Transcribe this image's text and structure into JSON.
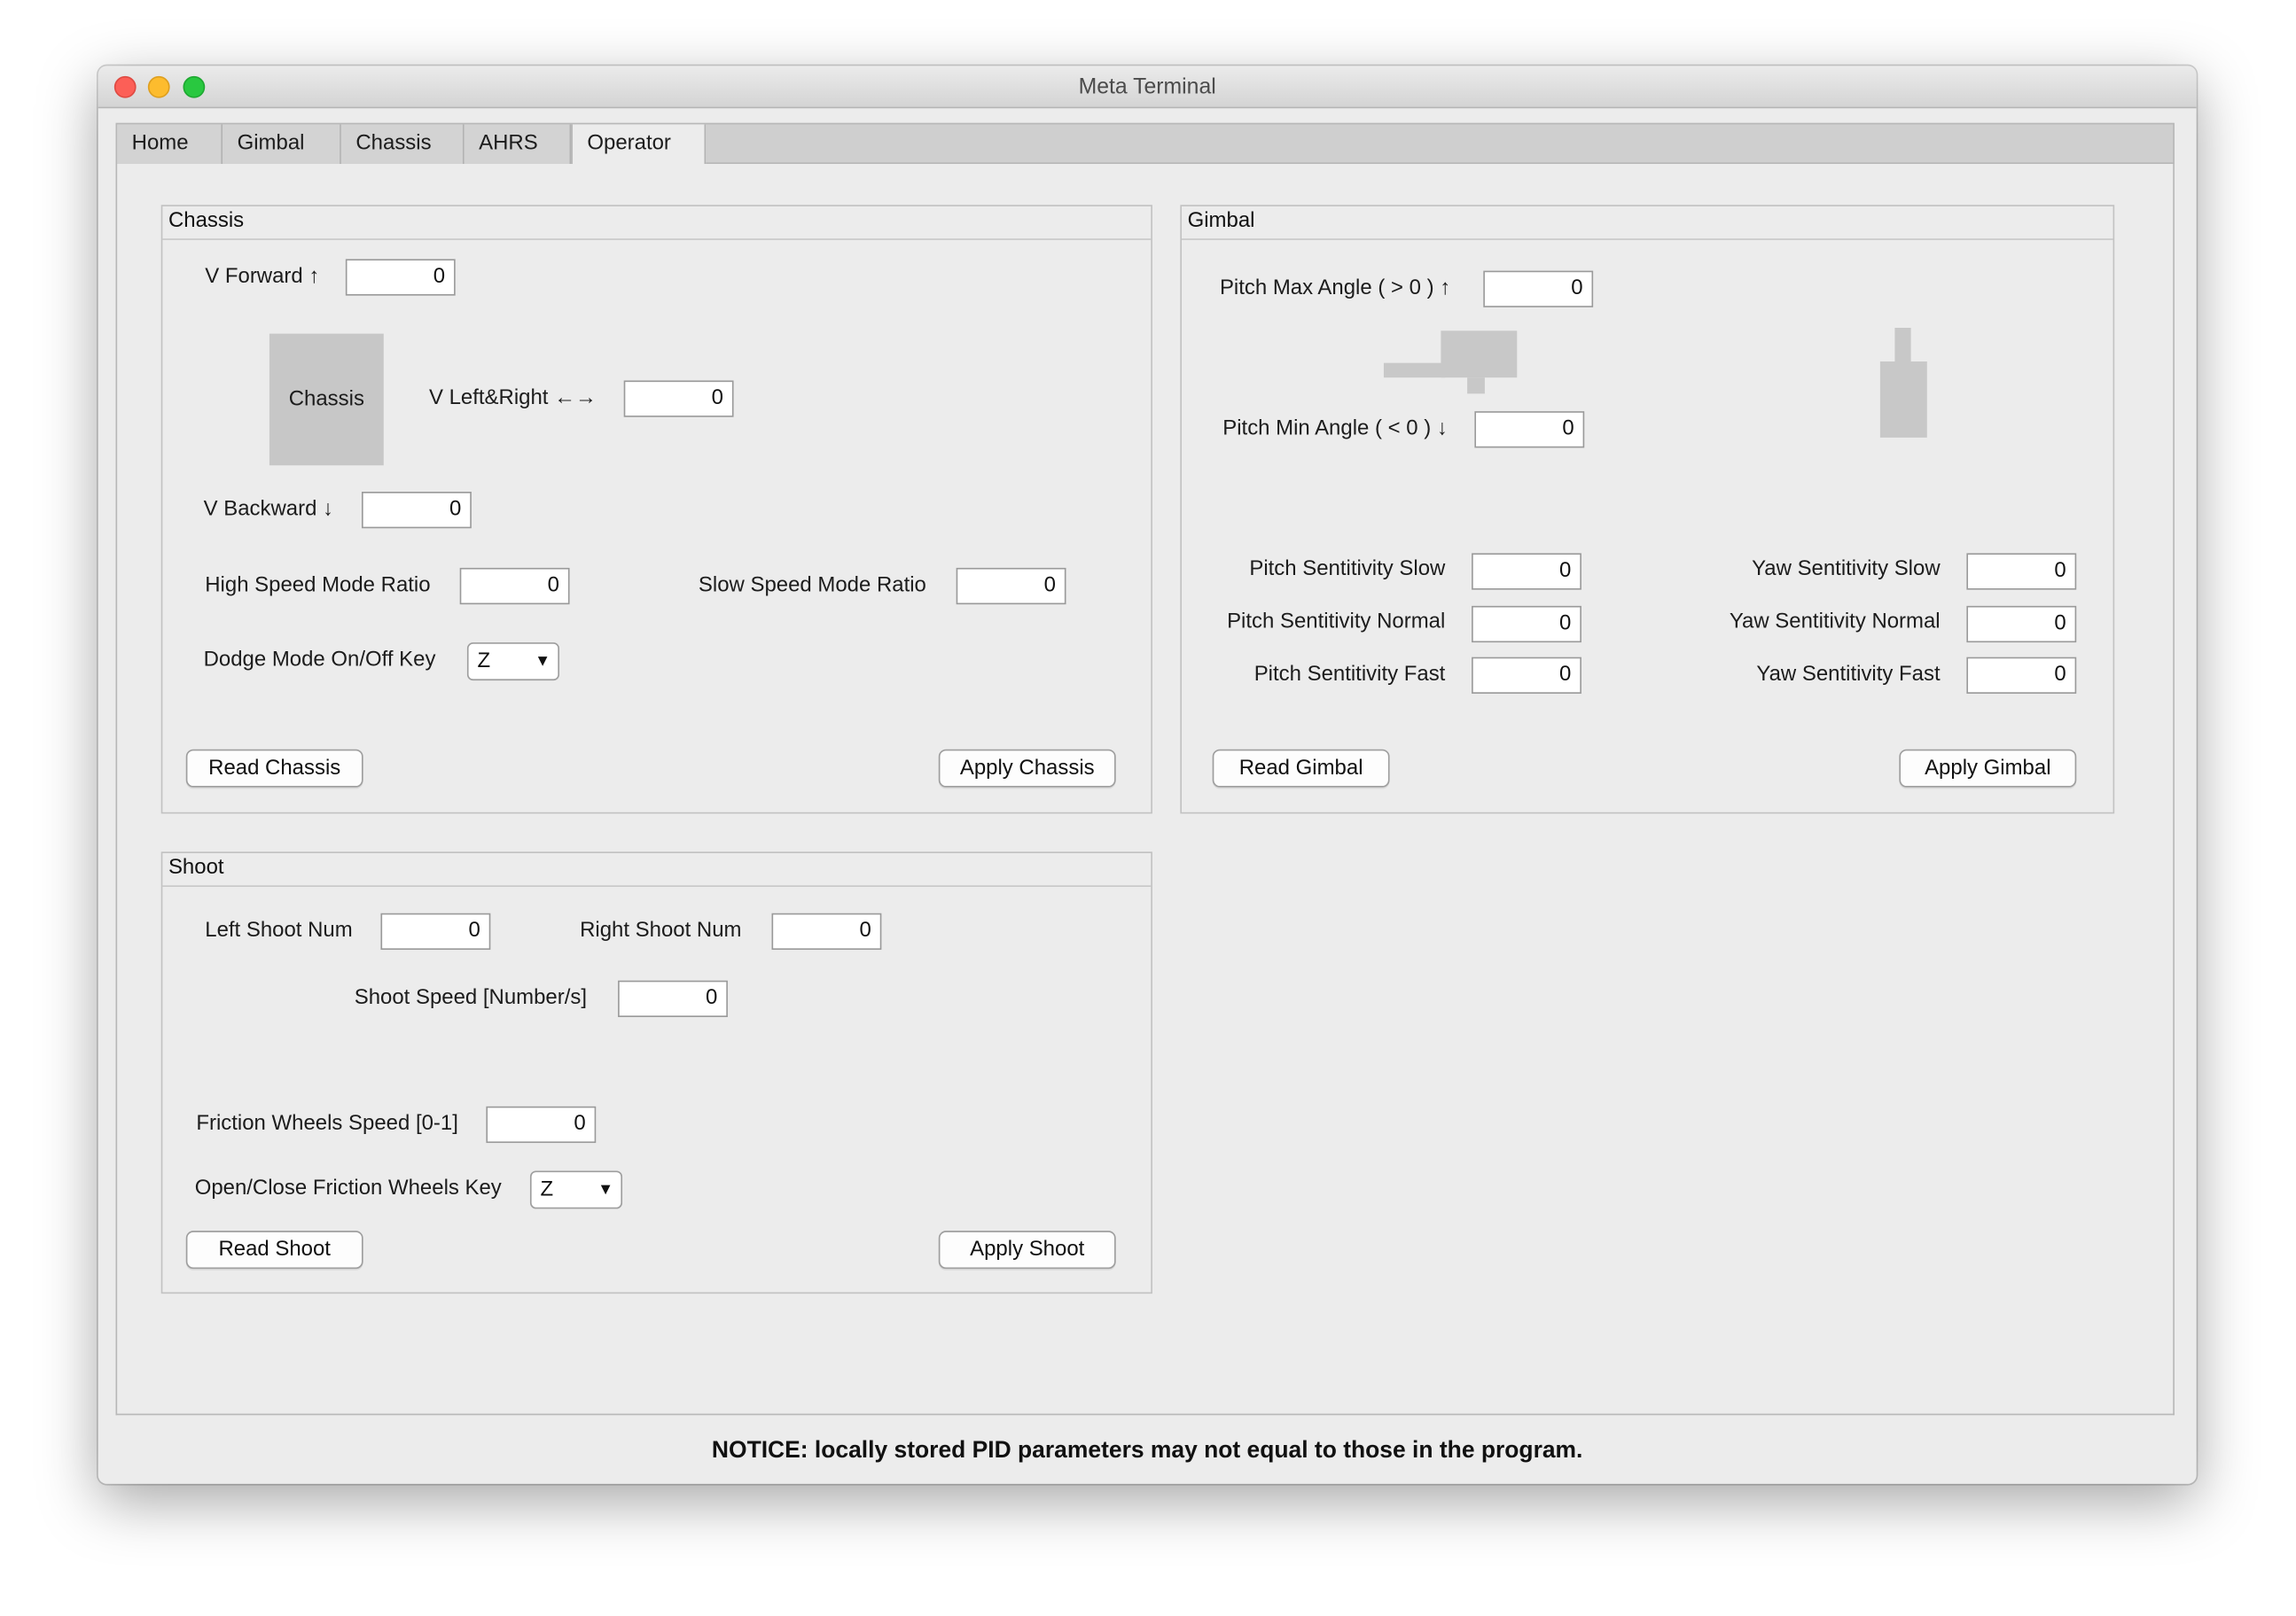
{
  "window": {
    "title": "Meta Terminal"
  },
  "tabs": [
    "Home",
    "Gimbal",
    "Chassis",
    "AHRS",
    "Operator"
  ],
  "chassis": {
    "title": "Chassis",
    "v_forward_label": "V Forward ↑",
    "v_forward": "0",
    "box_label": "Chassis",
    "v_leftright_label": "V Left&Right ←→",
    "v_leftright": "0",
    "v_backward_label": "V Backward ↓",
    "v_backward": "0",
    "high_ratio_label": "High Speed Mode Ratio",
    "high_ratio": "0",
    "slow_ratio_label": "Slow Speed Mode Ratio",
    "slow_ratio": "0",
    "dodge_label": "Dodge Mode On/Off Key",
    "dodge_key": "Z",
    "read_button": "Read Chassis",
    "apply_button": "Apply Chassis"
  },
  "gimbal": {
    "title": "Gimbal",
    "pitch_max_label": "Pitch Max Angle ( > 0 ) ↑",
    "pitch_max": "0",
    "pitch_min_label": "Pitch Min Angle ( < 0 ) ↓",
    "pitch_min": "0",
    "pitch_slow_label": "Pitch Sentitivity Slow",
    "pitch_slow": "0",
    "pitch_normal_label": "Pitch Sentitivity Normal",
    "pitch_normal": "0",
    "pitch_fast_label": "Pitch Sentitivity Fast",
    "pitch_fast": "0",
    "yaw_slow_label": "Yaw Sentitivity Slow",
    "yaw_slow": "0",
    "yaw_normal_label": "Yaw Sentitivity Normal",
    "yaw_normal": "0",
    "yaw_fast_label": "Yaw Sentitivity Fast",
    "yaw_fast": "0",
    "read_button": "Read Gimbal",
    "apply_button": "Apply Gimbal"
  },
  "shoot": {
    "title": "Shoot",
    "left_label": "Left Shoot Num",
    "left_num": "0",
    "right_label": "Right Shoot Num",
    "right_num": "0",
    "speed_label": "Shoot Speed [Number/s]",
    "speed": "0",
    "friction_label": "Friction Wheels Speed [0-1]",
    "friction": "0",
    "friction_key_label": "Open/Close Friction Wheels Key",
    "friction_key": "Z",
    "read_button": "Read Shoot",
    "apply_button": "Apply Shoot"
  },
  "notice": "NOTICE: locally stored PID parameters may not equal to those in the program."
}
